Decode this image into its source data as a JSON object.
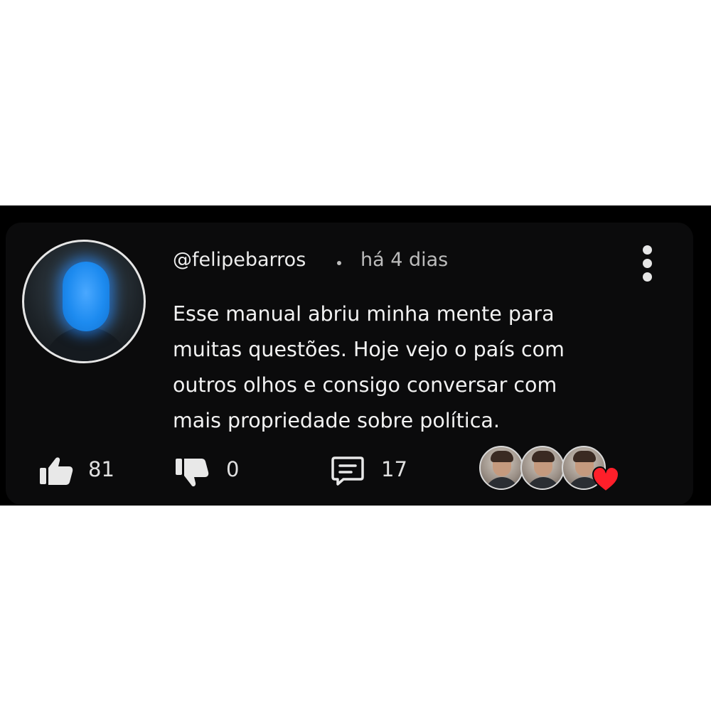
{
  "comment": {
    "username": "@felipebarros",
    "timestamp": "há 4 dias",
    "text_lines": [
      "Esse manual abriu minha mente para",
      "muitas questões. Hoje vejo o país com",
      "outros olhos e consigo conversar com",
      "mais propriedade sobre política."
    ]
  },
  "actions": {
    "likes": "81",
    "dislikes": "0",
    "replies": "17"
  },
  "colors": {
    "background": "#0b0b0c",
    "text": "#f2f2f2",
    "heart": "#ff1f2a",
    "avatar_glow": "#1d8bf0"
  },
  "icons": [
    "thumbs-up-icon",
    "thumbs-down-icon",
    "reply-icon",
    "more-options-icon",
    "heart-icon"
  ]
}
